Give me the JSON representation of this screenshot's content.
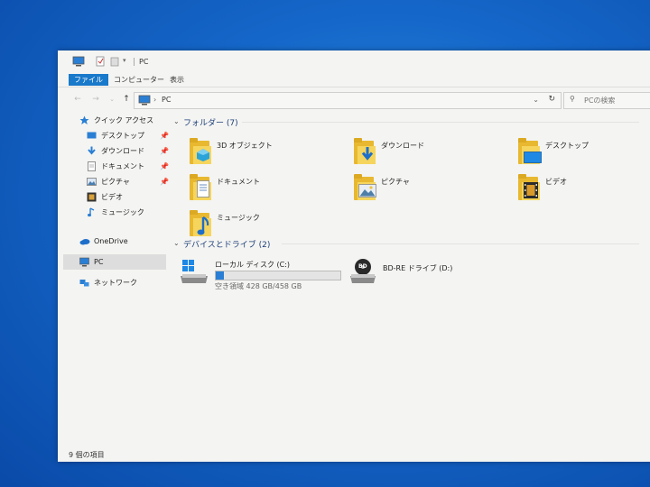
{
  "window": {
    "title": "PC"
  },
  "ribbon": {
    "tabs": [
      "ファイル",
      "コンピューター",
      "表示"
    ]
  },
  "address": {
    "path": "PC",
    "search_placeholder": "PCの検索"
  },
  "sidebar": {
    "quick_access": "クイック アクセス",
    "quick_items": [
      {
        "label": "デスクトップ",
        "icon": "desktop-icon",
        "pinned": true
      },
      {
        "label": "ダウンロード",
        "icon": "download-icon",
        "pinned": true
      },
      {
        "label": "ドキュメント",
        "icon": "document-icon",
        "pinned": true
      },
      {
        "label": "ピクチャ",
        "icon": "picture-icon",
        "pinned": true
      },
      {
        "label": "ビデオ",
        "icon": "video-icon",
        "pinned": false
      },
      {
        "label": "ミュージック",
        "icon": "music-icon",
        "pinned": false
      }
    ],
    "onedrive": "OneDrive",
    "pc": "PC",
    "network": "ネットワーク"
  },
  "main": {
    "folders_header": "フォルダー (7)",
    "folders": [
      {
        "label": "3D オブジェクト",
        "icon": "3d-objects-icon"
      },
      {
        "label": "ダウンロード",
        "icon": "download-icon"
      },
      {
        "label": "デスクトップ",
        "icon": "desktop-icon"
      },
      {
        "label": "ドキュメント",
        "icon": "document-icon"
      },
      {
        "label": "ピクチャ",
        "icon": "picture-icon"
      },
      {
        "label": "ビデオ",
        "icon": "video-icon"
      },
      {
        "label": "ミュージック",
        "icon": "music-icon"
      }
    ],
    "drives_header": "デバイスとドライブ (2)",
    "drives": [
      {
        "label": "ローカル ディスク (C:)",
        "space": "空き領域 428 GB/458 GB",
        "used_fraction": 0.066
      },
      {
        "label": "BD-RE ドライブ (D:)",
        "disc_text": "BD"
      }
    ]
  },
  "status": {
    "items_count": "9 個の項目"
  },
  "colors": {
    "accent": "#1979ca",
    "folder": "#f6d55c",
    "drive_bar": "#2a7fd4"
  }
}
